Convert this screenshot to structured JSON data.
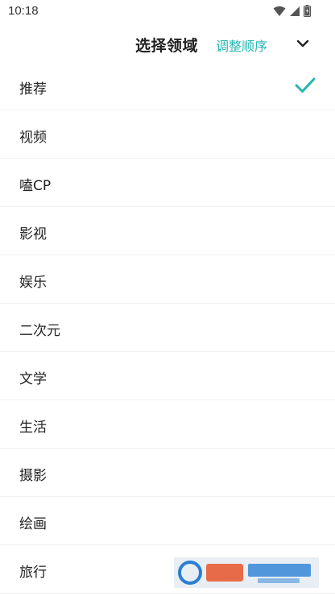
{
  "status_bar": {
    "time": "10:18",
    "icons": [
      "wifi-icon",
      "signal-icon",
      "battery-icon"
    ]
  },
  "header": {
    "title": "选择领域",
    "action_label": "调整顺序",
    "collapse_icon": "chevron-down-icon"
  },
  "domains": {
    "items": [
      {
        "label": "推荐",
        "selected": true
      },
      {
        "label": "视频",
        "selected": false
      },
      {
        "label": "嗑CP",
        "selected": false
      },
      {
        "label": "影视",
        "selected": false
      },
      {
        "label": "娱乐",
        "selected": false
      },
      {
        "label": "二次元",
        "selected": false
      },
      {
        "label": "文学",
        "selected": false
      },
      {
        "label": "生活",
        "selected": false
      },
      {
        "label": "摄影",
        "selected": false
      },
      {
        "label": "绘画",
        "selected": false
      },
      {
        "label": "旅行",
        "selected": false
      }
    ]
  },
  "colors": {
    "accent": "#26b5b0",
    "text": "#222222",
    "divider": "#f0f0f0",
    "background": "#ffffff"
  }
}
